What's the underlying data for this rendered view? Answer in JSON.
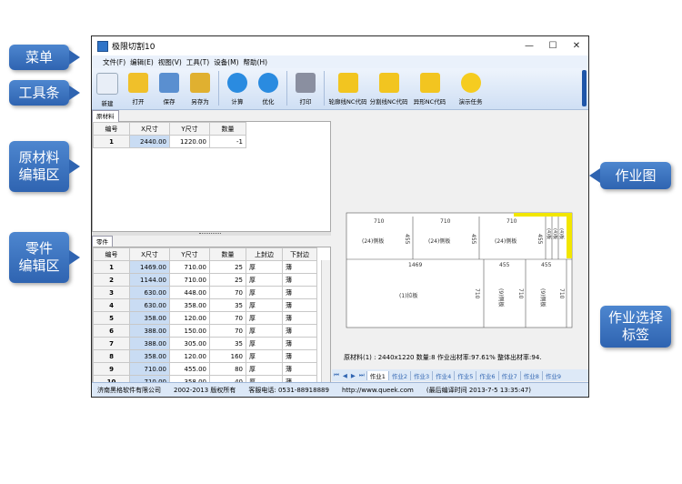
{
  "callouts": {
    "menu": "菜单",
    "toolbar": "工具条",
    "material_line1": "原材料",
    "material_line2": "编辑区",
    "parts_line1": "零件",
    "parts_line2": "编辑区",
    "job_diagram": "作业图",
    "job_tab_line1": "作业选择",
    "job_tab_line2": "标签"
  },
  "window": {
    "title": "极限切割10",
    "minimize": "—",
    "maximize": "☐",
    "close": "✕"
  },
  "menu": [
    "文件(F)",
    "编辑(E)",
    "视图(V)",
    "工具(T)",
    "设备(M)",
    "帮助(H)"
  ],
  "toolbar": [
    {
      "label": "新建",
      "icon": "new-doc-icon",
      "color": "#e8eef7"
    },
    {
      "label": "打开",
      "icon": "open-folder-icon",
      "color": "#f0c02a"
    },
    {
      "label": "保存",
      "icon": "save-disk-icon",
      "color": "#5a8fd0"
    },
    {
      "label": "另存为",
      "icon": "save-as-icon",
      "color": "#e0b030"
    },
    {
      "label": "计算",
      "icon": "play-icon",
      "color": "#2a8be0"
    },
    {
      "label": "优化",
      "icon": "eject-icon",
      "color": "#2a8be0"
    },
    {
      "label": "打印",
      "icon": "printer-icon",
      "color": "#8a8fa0"
    },
    {
      "label": "轮廓线NC代码",
      "icon": "pin-icon",
      "color": "#f2c520"
    },
    {
      "label": "分割线NC代码",
      "icon": "pin-icon",
      "color": "#f2c520"
    },
    {
      "label": "异形NC代码",
      "icon": "pin-icon",
      "color": "#f2c520"
    },
    {
      "label": "演示任务",
      "icon": "smiley-icon",
      "color": "#f5cc20"
    }
  ],
  "material": {
    "tab": "原材料",
    "headers": [
      "编号",
      "X尺寸",
      "Y尺寸",
      "数量"
    ],
    "rows": [
      [
        "1",
        "2440.00",
        "1220.00",
        "-1"
      ]
    ]
  },
  "parts": {
    "tab": "零件",
    "headers": [
      "编号",
      "X尺寸",
      "Y尺寸",
      "数量",
      "上封边",
      "下封边"
    ],
    "rows": [
      [
        "1",
        "1469.00",
        "710.00",
        "25",
        "厚",
        "薄"
      ],
      [
        "2",
        "1144.00",
        "710.00",
        "25",
        "厚",
        "薄"
      ],
      [
        "3",
        "630.00",
        "448.00",
        "70",
        "厚",
        "薄"
      ],
      [
        "4",
        "630.00",
        "358.00",
        "35",
        "厚",
        "薄"
      ],
      [
        "5",
        "358.00",
        "120.00",
        "70",
        "厚",
        "薄"
      ],
      [
        "6",
        "388.00",
        "150.00",
        "70",
        "厚",
        "薄"
      ],
      [
        "7",
        "388.00",
        "305.00",
        "35",
        "厚",
        "薄"
      ],
      [
        "8",
        "358.00",
        "120.00",
        "160",
        "厚",
        "薄"
      ],
      [
        "9",
        "710.00",
        "455.00",
        "80",
        "厚",
        "薄"
      ],
      [
        "10",
        "710.00",
        "358.00",
        "40",
        "厚",
        "薄"
      ]
    ]
  },
  "layout": {
    "top_widths": [
      "710",
      "710",
      "710"
    ],
    "top_heights": [
      "455",
      "455",
      "455"
    ],
    "top_labels": [
      "(24)侧板",
      "(24)侧板",
      "(24)侧板"
    ],
    "narrow_labels": [
      "(4)板",
      "(4)板",
      "(4)板"
    ],
    "bottom_width": "1469",
    "bottom_label": "(1)拉板",
    "bottom_height": "710",
    "side_width1": "455",
    "side_width2": "455",
    "side_height1": "710",
    "side_height2": "710",
    "side_label1": "(9)侧板",
    "side_label2": "(9)侧板"
  },
  "stats": "原材料(1) :  2440x1220   数量:8   作业出材率:97.61%   整体出材率:94.",
  "job_tabs": {
    "nav": [
      "⏮",
      "◀",
      "▶",
      "⏭"
    ],
    "tabs": [
      "作业1",
      "作业2",
      "作业3",
      "作业4",
      "作业5",
      "作业6",
      "作业7",
      "作业8",
      "作业9"
    ]
  },
  "statusbar": [
    "济南黑格软件有限公司",
    "2002-2013 版权所有",
    "客服电话: 0531-88918889",
    "http://www.queek.com",
    "(最后编译时间 2013-7-5 13:35:47)"
  ]
}
